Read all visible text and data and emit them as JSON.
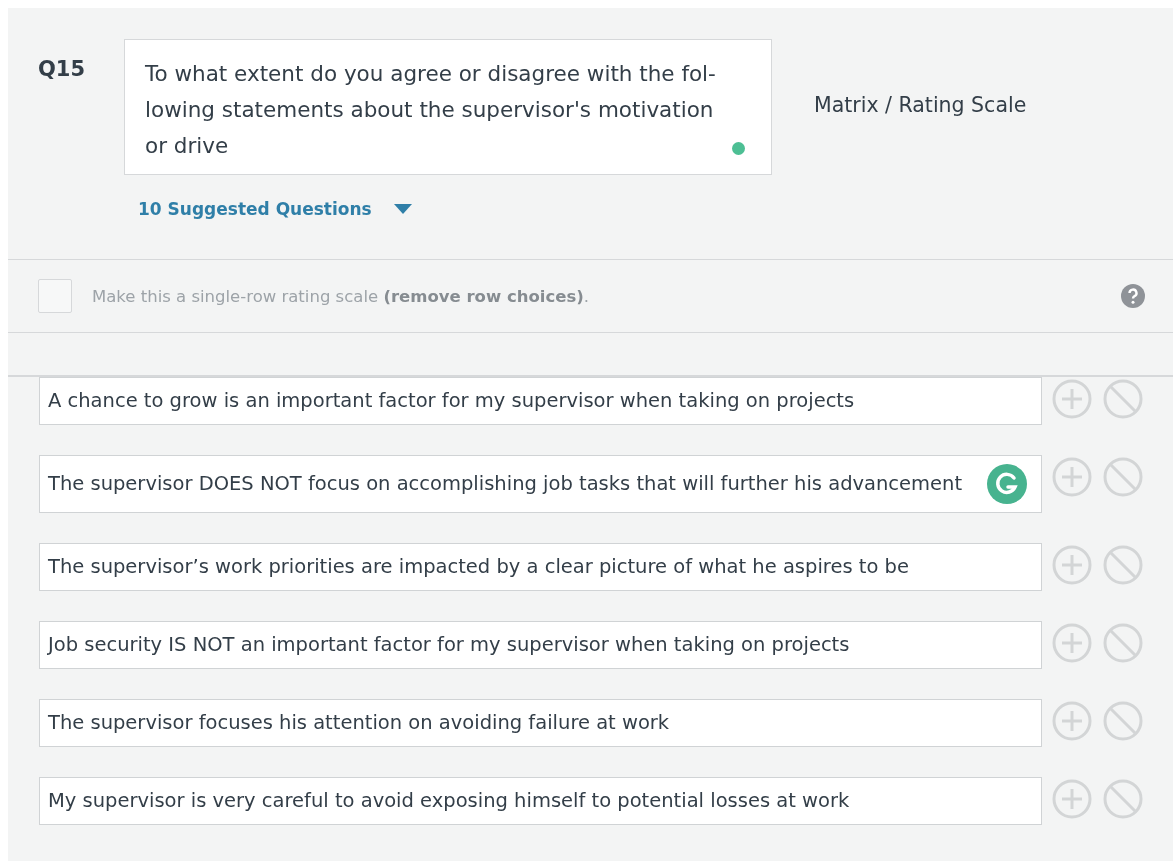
{
  "question": {
    "number": "Q15",
    "text_lines": [
      "To what extent do you agree or disagree with the fol-",
      "lowing statements about the supervisor's motivation",
      "or drive"
    ],
    "type": "Matrix / Rating Scale",
    "suggestions": "10 Suggested Questions"
  },
  "single_row": {
    "checked": false,
    "text": "Make this a single-row rating scale **(remove row choices)**."
  },
  "rows": [
    {
      "text": "A chance to grow is an important factor for my supervisor when taking on projects",
      "grammar_badge": false
    },
    {
      "text": "The supervisor DOES NOT focus on accomplishing job tasks that will further his advancement",
      "grammar_badge": true
    },
    {
      "text": "The supervisor’s work priorities are impacted by a clear picture of what he aspires to be",
      "grammar_badge": false
    },
    {
      "text": "Job security IS NOT an important factor for my supervisor when taking on projects",
      "grammar_badge": false
    },
    {
      "text": "The supervisor focuses his attention on avoiding failure at work",
      "grammar_badge": false
    },
    {
      "text": "My supervisor is very careful to avoid exposing himself to potential losses at work",
      "grammar_badge": false
    }
  ]
}
